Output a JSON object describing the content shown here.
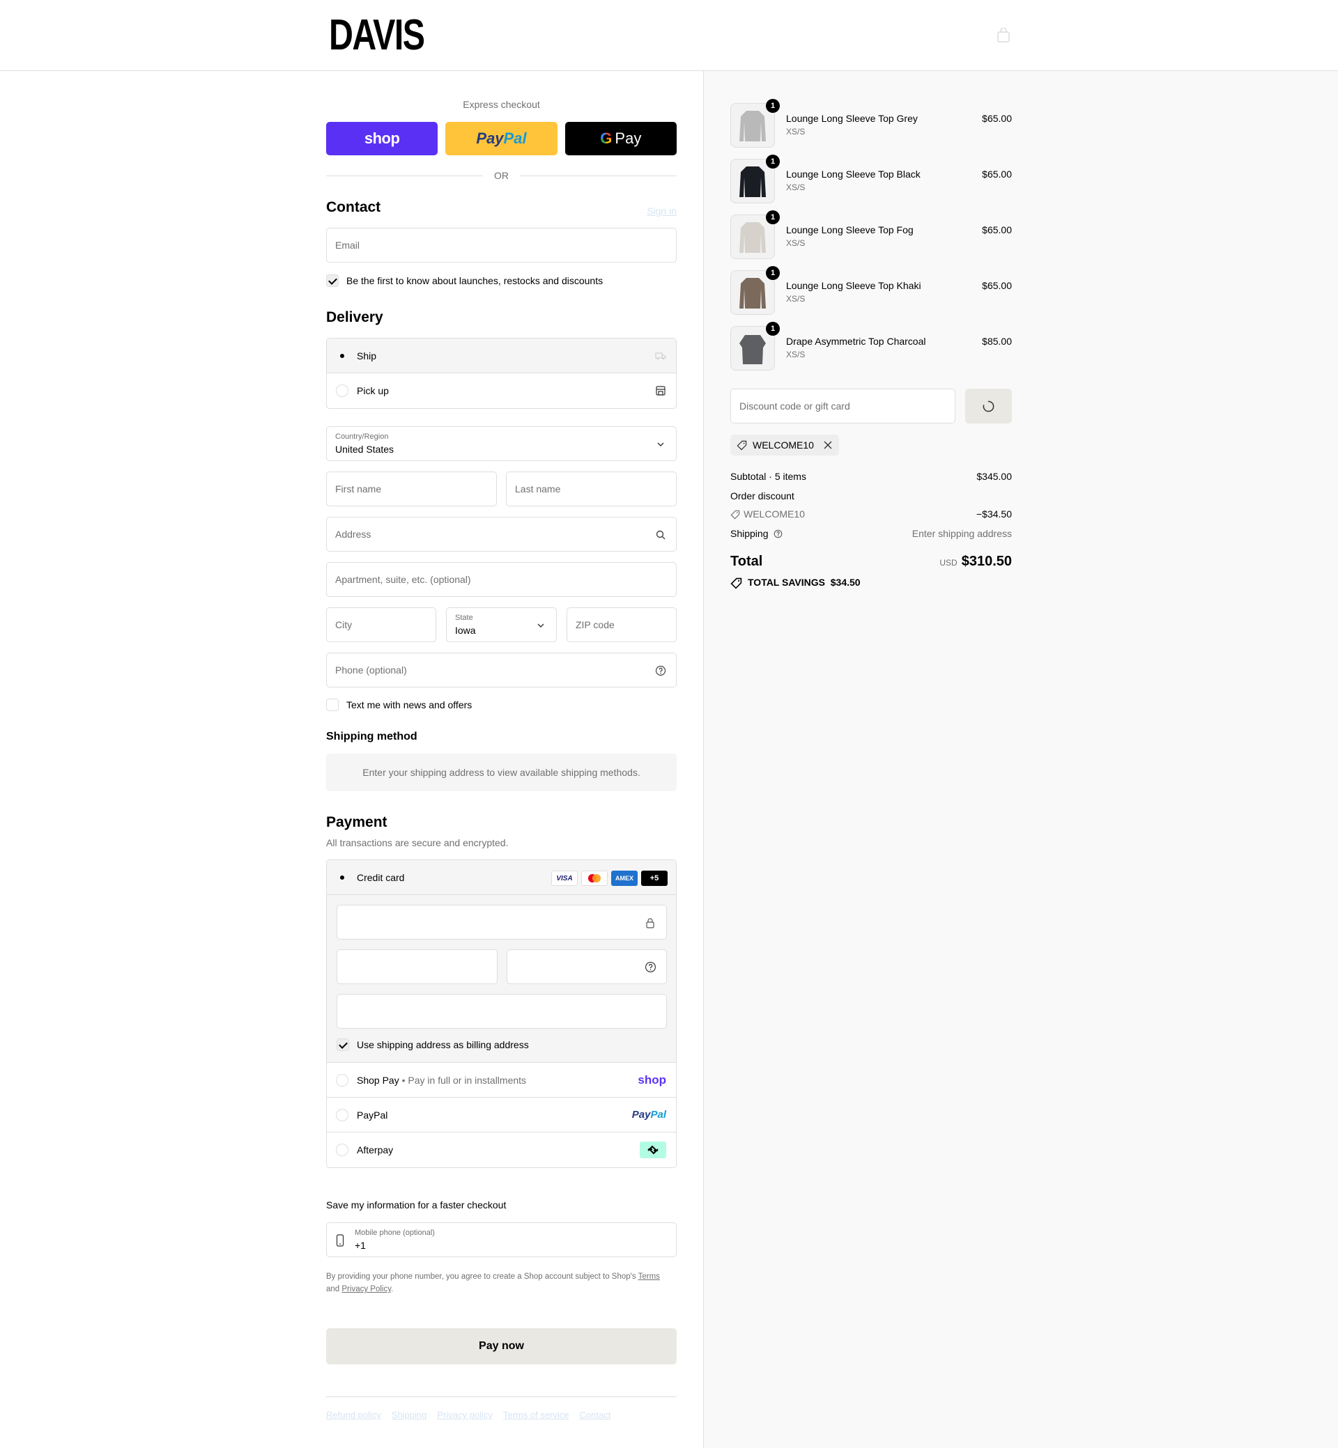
{
  "header": {
    "logo": "DAVIS"
  },
  "express": {
    "label": "Express checkout",
    "shop": "shop",
    "paypal_a": "Pay",
    "paypal_b": "Pal",
    "gpay_g": "G",
    "gpay_text": "Pay",
    "or": "OR"
  },
  "contact": {
    "title": "Contact",
    "signin": "Sign in",
    "email_placeholder": "Email",
    "marketing_label": "Be the first to know about launches, restocks and discounts",
    "marketing_checked": true
  },
  "delivery": {
    "title": "Delivery",
    "options": [
      {
        "label": "Ship",
        "selected": true
      },
      {
        "label": "Pick up",
        "selected": false
      }
    ],
    "country_label": "Country/Region",
    "country_value": "United States",
    "first_name": "First name",
    "last_name": "Last name",
    "address": "Address",
    "apartment": "Apartment, suite, etc. (optional)",
    "city": "City",
    "state_label": "State",
    "state_value": "Iowa",
    "zip": "ZIP code",
    "phone": "Phone (optional)",
    "sms_label": "Text me with news and offers"
  },
  "shipping_method": {
    "title": "Shipping method",
    "info": "Enter your shipping address to view available shipping methods."
  },
  "payment": {
    "title": "Payment",
    "subtitle": "All transactions are secure and encrypted.",
    "credit_card": "Credit card",
    "brands": [
      "VISA",
      "",
      "AMEX",
      "+5"
    ],
    "billing_label": "Use shipping address as billing address",
    "shop_pay": "Shop Pay",
    "shop_pay_sub": "Pay in full or in installments",
    "shop_logo": "shop",
    "paypal": "PayPal",
    "paypal_logo_a": "Pay",
    "paypal_logo_b": "Pal",
    "afterpay": "Afterpay"
  },
  "save": {
    "title": "Save my information for a faster checkout",
    "phone_label": "Mobile phone (optional)",
    "phone_value": "+1",
    "fine_a": "By providing your phone number, you agree to create a Shop account subject to Shop's ",
    "terms": "Terms",
    "fine_b": " and ",
    "privacy": "Privacy Policy",
    "fine_c": "."
  },
  "pay_now": "Pay now",
  "footer": [
    "Refund policy",
    "Shipping",
    "Privacy policy",
    "Terms of service",
    "Contact"
  ],
  "cart": {
    "items": [
      {
        "name": "Lounge Long Sleeve Top Grey",
        "variant": "XS/S",
        "price": "$65.00",
        "qty": "1",
        "color": "#b9b9b9"
      },
      {
        "name": "Lounge Long Sleeve Top Black",
        "variant": "XS/S",
        "price": "$65.00",
        "qty": "1",
        "color": "#1a1d24"
      },
      {
        "name": "Lounge Long Sleeve Top Fog",
        "variant": "XS/S",
        "price": "$65.00",
        "qty": "1",
        "color": "#d6d1cb"
      },
      {
        "name": "Lounge Long Sleeve Top Khaki",
        "variant": "XS/S",
        "price": "$65.00",
        "qty": "1",
        "color": "#7b6a5c"
      },
      {
        "name": "Drape Asymmetric Top Charcoal",
        "variant": "XS/S",
        "price": "$85.00",
        "qty": "1",
        "color": "#5e5f63"
      }
    ],
    "discount_placeholder": "Discount code or gift card",
    "applied_code": "WELCOME10",
    "subtotal_label": "Subtotal · 5 items",
    "subtotal": "$345.00",
    "order_discount_label": "Order discount",
    "discount_code": "WELCOME10",
    "discount_value": "−$34.50",
    "shipping_label": "Shipping",
    "shipping_value": "Enter shipping address",
    "total_label": "Total",
    "currency": "USD",
    "total": "$310.50",
    "savings_label": "TOTAL SAVINGS",
    "savings_value": "$34.50"
  }
}
